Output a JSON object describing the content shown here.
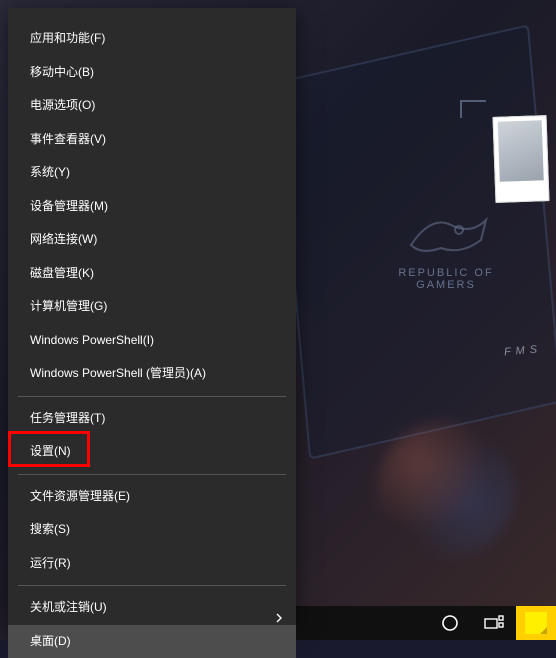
{
  "context_menu": {
    "groups": [
      [
        {
          "label": "应用和功能(F)",
          "name": "menu-apps-and-features"
        },
        {
          "label": "移动中心(B)",
          "name": "menu-mobility-center"
        },
        {
          "label": "电源选项(O)",
          "name": "menu-power-options"
        },
        {
          "label": "事件查看器(V)",
          "name": "menu-event-viewer"
        },
        {
          "label": "系统(Y)",
          "name": "menu-system"
        },
        {
          "label": "设备管理器(M)",
          "name": "menu-device-manager"
        },
        {
          "label": "网络连接(W)",
          "name": "menu-network-connections"
        },
        {
          "label": "磁盘管理(K)",
          "name": "menu-disk-management"
        },
        {
          "label": "计算机管理(G)",
          "name": "menu-computer-management"
        },
        {
          "label": "Windows PowerShell(I)",
          "name": "menu-powershell"
        },
        {
          "label": "Windows PowerShell (管理员)(A)",
          "name": "menu-powershell-admin"
        }
      ],
      [
        {
          "label": "任务管理器(T)",
          "name": "menu-task-manager"
        },
        {
          "label": "设置(N)",
          "name": "menu-settings",
          "highlighted": true
        }
      ],
      [
        {
          "label": "文件资源管理器(E)",
          "name": "menu-file-explorer"
        },
        {
          "label": "搜索(S)",
          "name": "menu-search"
        },
        {
          "label": "运行(R)",
          "name": "menu-run"
        }
      ],
      [
        {
          "label": "关机或注销(U)",
          "name": "menu-shutdown-signout",
          "has_submenu": true
        },
        {
          "label": "桌面(D)",
          "name": "menu-desktop",
          "hover": true
        }
      ]
    ]
  },
  "desktop": {
    "brand_text": "REPUBLIC OF GAMERS",
    "fms_text": "F M S"
  },
  "taskbar": {
    "items": [
      {
        "name": "cortana-icon"
      },
      {
        "name": "task-view-icon"
      },
      {
        "name": "sticky-notes-icon"
      }
    ]
  }
}
